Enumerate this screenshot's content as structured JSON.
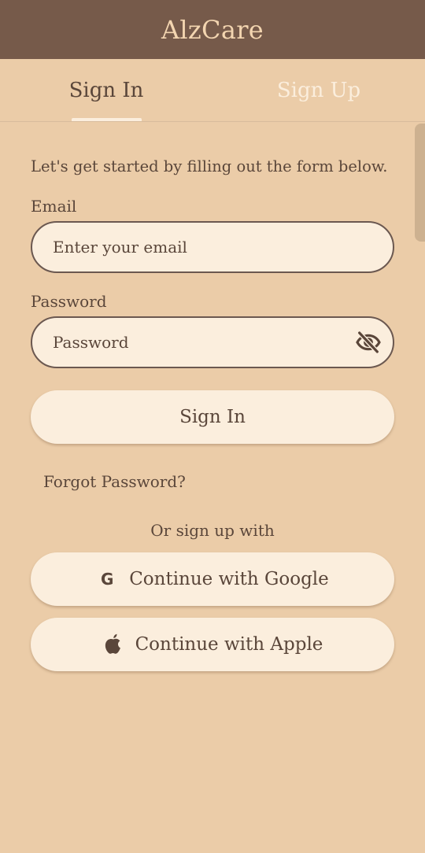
{
  "app": {
    "title": "AlzCare"
  },
  "tabs": [
    {
      "label": "Sign In",
      "active": true
    },
    {
      "label": "Sign Up",
      "active": false
    }
  ],
  "form": {
    "subtitle": "Let's get started by filling out the form below.",
    "email": {
      "label": "Email",
      "placeholder": "Enter your email",
      "value": ""
    },
    "password": {
      "label": "Password",
      "placeholder": "Password",
      "value": "",
      "toggle_icon": "eye-off-icon"
    },
    "submit_label": "Sign In",
    "forgot_label": "Forgot Password?"
  },
  "social": {
    "divider_text": "Or sign up with",
    "buttons": [
      {
        "label": "Continue with Google",
        "icon": "google-icon",
        "glyph": "G"
      },
      {
        "label": "Continue with Apple",
        "icon": "apple-icon"
      }
    ]
  },
  "colors": {
    "app_bar": "#765a4a",
    "background": "#ebcca8",
    "surface": "#fbeedd",
    "text": "#5a463a",
    "title": "#f3d5b0"
  }
}
